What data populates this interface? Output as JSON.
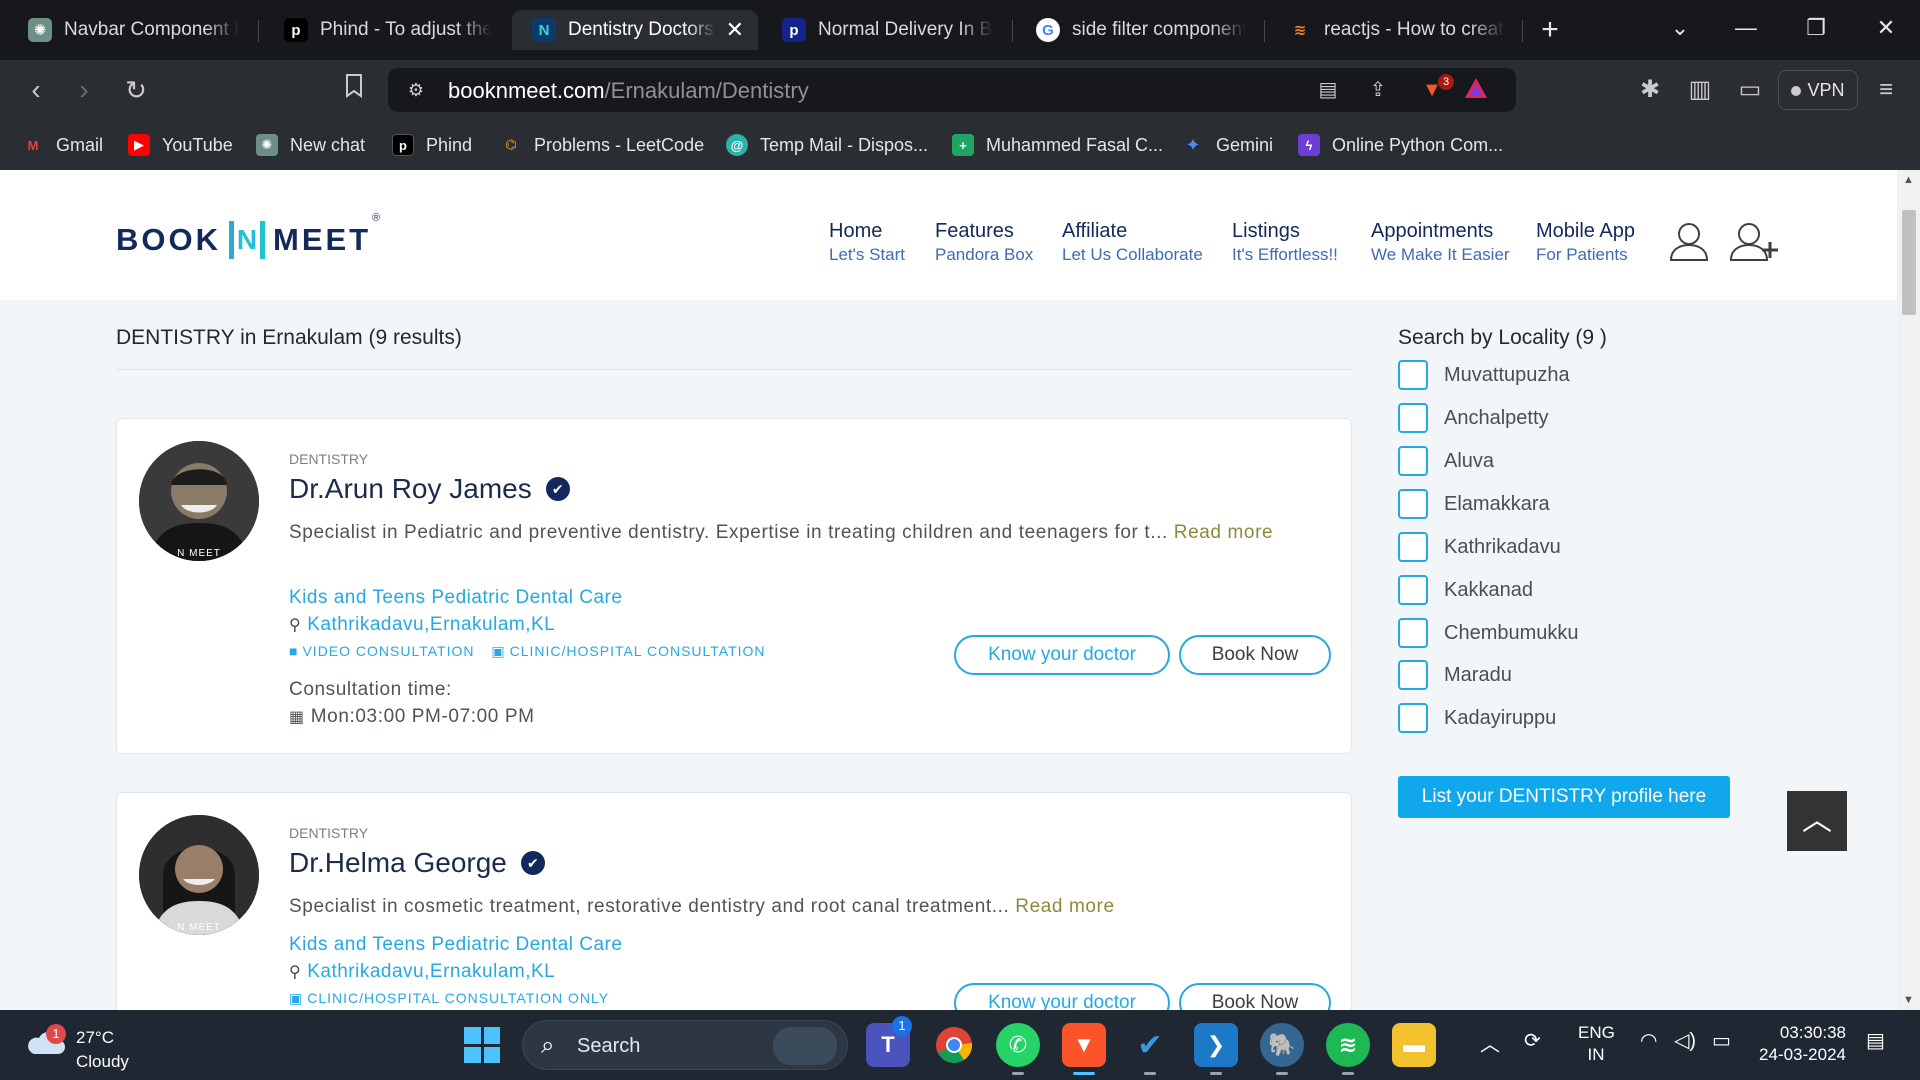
{
  "browser": {
    "tabs": [
      {
        "title": "Navbar Component Imp",
        "favicon": "chatgpt-icon",
        "active": false
      },
      {
        "title": "Phind - To adjust the la",
        "favicon": "phind-icon",
        "active": false
      },
      {
        "title": "Dentistry Doctors i",
        "favicon": "booknmeet-icon",
        "active": true
      },
      {
        "title": "Normal Delivery In Ban",
        "favicon": "practo-icon",
        "active": false
      },
      {
        "title": "side filter component r",
        "favicon": "google-icon",
        "active": false
      },
      {
        "title": "reactjs - How to create",
        "favicon": "stackoverflow-icon",
        "active": false
      }
    ],
    "url_host": "booknmeet.com",
    "url_path": "/Ernakulam/Dentistry",
    "brave_badge": "3",
    "vpn_label": "VPN",
    "bookmarks": [
      {
        "label": "Gmail",
        "icon": "gmail-icon",
        "color": "#ea4335"
      },
      {
        "label": "YouTube",
        "icon": "youtube-icon",
        "color": "#ff0000"
      },
      {
        "label": "New chat",
        "icon": "chatgpt-icon",
        "color": "#7fa99b"
      },
      {
        "label": "Phind",
        "icon": "phind-icon",
        "color": "#000000"
      },
      {
        "label": "Problems - LeetCode",
        "icon": "leetcode-icon",
        "color": "#f89f1b"
      },
      {
        "label": "Temp Mail - Dispos...",
        "icon": "tempmail-icon",
        "color": "#2ab3a6"
      },
      {
        "label": "Muhammed Fasal C...",
        "icon": "plus-square-icon",
        "color": "#21a366"
      },
      {
        "label": "Gemini",
        "icon": "gemini-icon",
        "color": "#4b8bf5"
      },
      {
        "label": "Online Python Com...",
        "icon": "bolt-icon",
        "color": "#6b3fd6"
      }
    ]
  },
  "site": {
    "logo_left": "BOOK",
    "logo_mid": "N",
    "logo_right": "MEET",
    "logo_reg": "®",
    "nav": [
      {
        "title": "Home",
        "sub": "Let's Start"
      },
      {
        "title": "Features",
        "sub": "Pandora Box"
      },
      {
        "title": "Affiliate",
        "sub": "Let Us Collaborate"
      },
      {
        "title": "Listings",
        "sub": "It's Effortless!!"
      },
      {
        "title": "Appointments",
        "sub": "We Make It Easier"
      },
      {
        "title": "Mobile App",
        "sub": "For Patients"
      }
    ],
    "accent": "#26a8e2",
    "brand_navy": "#13295b"
  },
  "results": {
    "title": "DENTISTRY in Ernakulam (9 results)",
    "doctors": [
      {
        "category": "DENTISTRY",
        "name": "Dr.Arun Roy James",
        "description": "Specialist in Pediatric and preventive dentistry. Expertise in treating children and teenagers for t...",
        "read_more": "Read more",
        "clinic": "Kids and Teens Pediatric Dental Care",
        "location": "Kathrikadavu,Ernakulam,KL",
        "mode1": "VIDEO CONSULTATION",
        "mode2": "CLINIC/HOSPITAL CONSULTATION",
        "consult_label": "Consultation time:",
        "consult_time": "Mon:03:00 PM-07:00 PM",
        "know_label": "Know your doctor",
        "book_label": "Book Now",
        "avatar_stamp": "N MEET"
      },
      {
        "category": "DENTISTRY",
        "name": "Dr.Helma George",
        "description": "Specialist in cosmetic treatment, restorative dentistry and root canal treatment...",
        "read_more": "Read more",
        "clinic": "Kids and Teens Pediatric Dental Care",
        "location": "Kathrikadavu,Ernakulam,KL",
        "mode1": "CLINIC/HOSPITAL CONSULTATION ONLY",
        "know_label": "Know your doctor",
        "book_label": "Book Now",
        "avatar_stamp": "N MEET"
      }
    ]
  },
  "filter": {
    "title": "Search by Locality (9 )",
    "localities": [
      "Muvattupuzha",
      "Anchalpetty",
      "Aluva",
      "Elamakkara",
      "Kathrikadavu",
      "Kakkanad",
      "Chembumukku",
      "Maradu",
      "Kadayiruppu"
    ],
    "list_button": "List your DENTISTRY profile here"
  },
  "taskbar": {
    "weather_temp": "27°C",
    "weather_cond": "Cloudy",
    "weather_badge": "1",
    "search_label": "Search",
    "teams_badge": "1",
    "lang_line1": "ENG",
    "lang_line2": "IN",
    "time": "03:30:38",
    "date": "24-03-2024"
  }
}
